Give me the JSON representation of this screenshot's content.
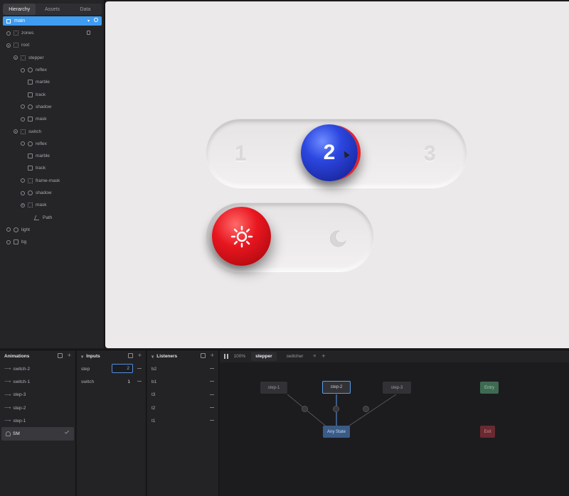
{
  "hierarchy": {
    "tabs": [
      {
        "label": "Hierarchy",
        "active": true
      },
      {
        "label": "Assets",
        "active": false
      },
      {
        "label": "Data",
        "active": false
      }
    ],
    "selected": {
      "label": "main"
    },
    "items": [
      {
        "label": "zones",
        "depth": 0,
        "icon": "group-icon",
        "open": false
      },
      {
        "label": "root",
        "depth": 0,
        "icon": "group-icon",
        "open": true
      },
      {
        "label": "stepper",
        "depth": 1,
        "icon": "group-icon",
        "open": true
      },
      {
        "label": "reflex",
        "depth": 2,
        "icon": "ellipse-icon",
        "open": false
      },
      {
        "label": "marble",
        "depth": 2,
        "icon": "image-icon",
        "open": null
      },
      {
        "label": "track",
        "depth": 2,
        "icon": "image-icon",
        "open": null
      },
      {
        "label": "shadow",
        "depth": 2,
        "icon": "ellipse-icon",
        "open": false
      },
      {
        "label": "mask",
        "depth": 2,
        "icon": "rect-icon",
        "open": false
      },
      {
        "label": "switch",
        "depth": 1,
        "icon": "group-icon",
        "open": true
      },
      {
        "label": "reflex",
        "depth": 2,
        "icon": "ellipse-icon",
        "open": false
      },
      {
        "label": "marble",
        "depth": 2,
        "icon": "image-icon",
        "open": null
      },
      {
        "label": "track",
        "depth": 2,
        "icon": "image-icon",
        "open": null
      },
      {
        "label": "frame-mask",
        "depth": 2,
        "icon": "group-icon",
        "open": false
      },
      {
        "label": "shadow",
        "depth": 2,
        "icon": "ellipse-icon",
        "open": false
      },
      {
        "label": "mask",
        "depth": 2,
        "icon": "shape-icon",
        "open": true
      },
      {
        "label": "Path",
        "depth": 3,
        "icon": "path-icon",
        "open": null
      },
      {
        "label": "light",
        "depth": 0,
        "icon": "ellipse-icon",
        "open": false
      },
      {
        "label": "bg",
        "depth": 0,
        "icon": "rect-icon",
        "open": false
      }
    ]
  },
  "canvas": {
    "stepper": {
      "labels": [
        "1",
        "2",
        "3"
      ],
      "selected_label": "2",
      "marble_color": "#2c47e0"
    },
    "switch": {
      "marble_color": "#e8161f",
      "on_icon": "sun-icon",
      "off_icon": "moon-icon"
    }
  },
  "animations": {
    "title": "Animations",
    "items": [
      {
        "label": "switch-2"
      },
      {
        "label": "switch-1"
      },
      {
        "label": "step-3"
      },
      {
        "label": "step-2"
      },
      {
        "label": "step-1"
      }
    ],
    "state_machine": {
      "label": "SM"
    }
  },
  "inputs": {
    "title": "Inputs",
    "items": [
      {
        "label": "step",
        "value": "2"
      },
      {
        "label": "switch",
        "value": "1"
      }
    ]
  },
  "listeners": {
    "title": "Listeners",
    "items": [
      {
        "label": "b2"
      },
      {
        "label": "b1"
      },
      {
        "label": "t3"
      },
      {
        "label": "t2"
      },
      {
        "label": "t1"
      }
    ]
  },
  "graph": {
    "zoom": "100%",
    "tabs": [
      {
        "label": "stepper",
        "active": true
      },
      {
        "label": "switcher",
        "active": false
      }
    ],
    "nodes": {
      "step1": "step-1",
      "step2": "step-2",
      "step3": "step-3",
      "entry": "Entry",
      "any": "Any State",
      "exit": "Exit"
    }
  }
}
